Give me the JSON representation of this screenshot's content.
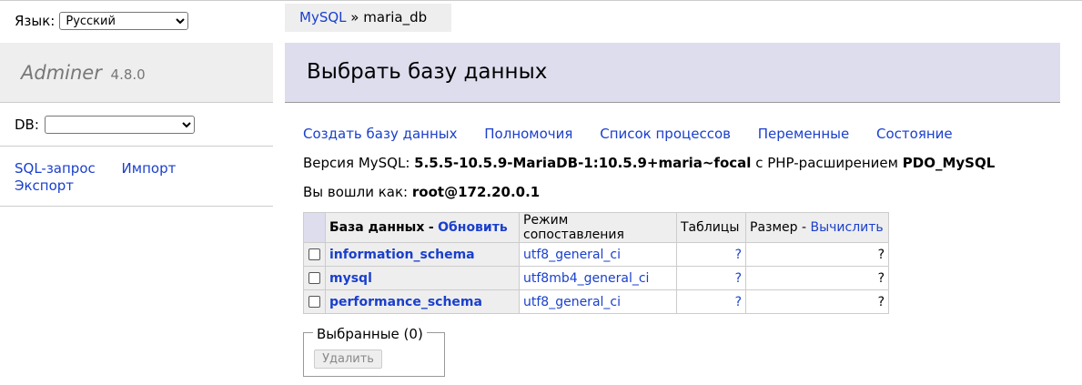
{
  "sidebar": {
    "lang_label": "Язык:",
    "lang_value": "Русский",
    "logo_name": "Adminer",
    "logo_version": "4.8.0",
    "db_label": "DB:",
    "db_value": "",
    "links": [
      "SQL-запрос",
      "Импорт",
      "Экспорт"
    ]
  },
  "breadcrumb": {
    "server": "MySQL",
    "separator": "»",
    "current": "maria_db"
  },
  "main": {
    "title": "Выбрать базу данных",
    "actions": [
      "Создать базу данных",
      "Полномочия",
      "Список процессов",
      "Переменные",
      "Состояние"
    ],
    "version_label": "Версия MySQL:",
    "version_value": "5.5.5-10.5.9-MariaDB-1:10.5.9+maria~focal",
    "php_label": "с PHP-расширением",
    "php_value": "PDO_MySQL",
    "login_label": "Вы вошли как:",
    "login_value": "root@172.20.0.1"
  },
  "table": {
    "col_db": "База данных",
    "col_db_sep": "-",
    "col_db_refresh": "Обновить",
    "col_collation": "Режим сопоставления",
    "col_tables": "Таблицы",
    "col_size": "Размер",
    "col_size_sep": "-",
    "col_size_compute": "Вычислить",
    "rows": [
      {
        "name": "information_schema",
        "collation": "utf8_general_ci",
        "tables": "?",
        "size": "?"
      },
      {
        "name": "mysql",
        "collation": "utf8mb4_general_ci",
        "tables": "?",
        "size": "?"
      },
      {
        "name": "performance_schema",
        "collation": "utf8_general_ci",
        "tables": "?",
        "size": "?"
      }
    ]
  },
  "selected": {
    "legend": "Выбранные (0)",
    "delete_label": "Удалить"
  }
}
